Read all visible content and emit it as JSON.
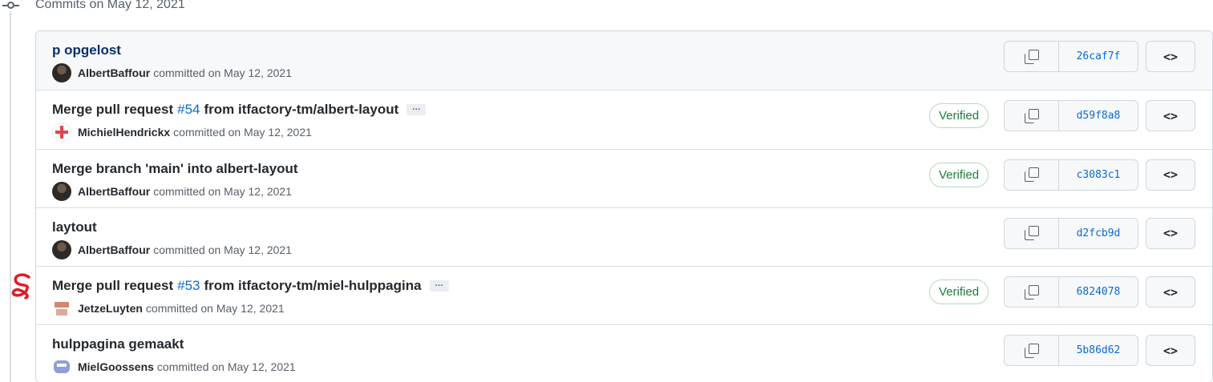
{
  "group": {
    "title": "Commits on May 12, 2021"
  },
  "commits": [
    {
      "title": "p opgelost",
      "author": "AlbertBaffour",
      "meta": "committed on May 12, 2021",
      "verified": "",
      "sha": "26caf7f",
      "avatar": "dark"
    },
    {
      "title_pre": "Merge pull request",
      "pr": "#54",
      "title_post": "from itfactory-tm/albert-layout",
      "ellipsis": "…",
      "author": "MichielHendrickx",
      "meta": "committed on May 12, 2021",
      "verified": "Verified",
      "sha": "d59f8a8",
      "avatar": "red"
    },
    {
      "title": "Merge branch 'main' into albert-layout",
      "author": "AlbertBaffour",
      "meta": "committed on May 12, 2021",
      "verified": "Verified",
      "sha": "c3083c1",
      "avatar": "dark"
    },
    {
      "title": "laytout",
      "author": "AlbertBaffour",
      "meta": "committed on May 12, 2021",
      "verified": "",
      "sha": "d2fcb9d",
      "avatar": "dark"
    },
    {
      "title_pre": "Merge pull request",
      "pr": "#53",
      "title_post": "from itfactory-tm/miel-hulppagina",
      "ellipsis": "…",
      "author": "JetzeLuyten",
      "meta": "committed on May 12, 2021",
      "verified": "Verified",
      "sha": "6824078",
      "avatar": "brown"
    },
    {
      "title": "hulppagina gemaakt",
      "author": "MielGoossens",
      "meta": "committed on May 12, 2021",
      "verified": "",
      "sha": "5b86d62",
      "avatar": "blue"
    }
  ],
  "icons": {
    "timeline": "git-commit-icon",
    "copy": "copy-icon",
    "browse": "code-icon",
    "browse_glyph": "<>"
  },
  "colors": {
    "link": "#0969da",
    "verified": "#1a7f37",
    "annotation": "#e01b24"
  }
}
